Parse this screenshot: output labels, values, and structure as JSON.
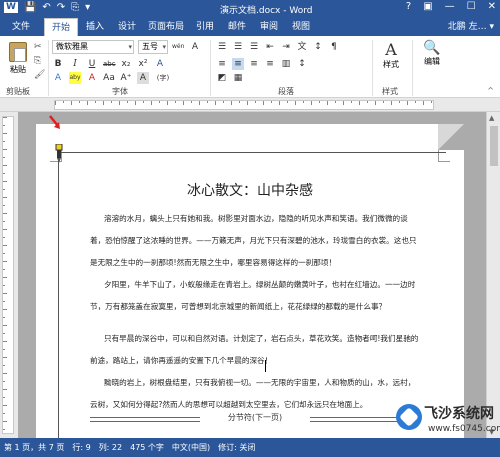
{
  "titlebar": {
    "quick_access": [
      "W",
      "💾",
      "↶",
      "↷",
      "⎘",
      "▾"
    ],
    "title": "演示文档.docx - Word",
    "window_buttons": [
      "?",
      "▣",
      "—",
      "☐",
      "✕"
    ]
  },
  "tabs": {
    "file": "文件",
    "items": [
      "开始",
      "插入",
      "设计",
      "页面布局",
      "引用",
      "邮件",
      "审阅",
      "视图"
    ],
    "active": "开始",
    "user": "北鹏 左… ▾"
  },
  "ribbon": {
    "paste_label": "粘贴",
    "clipboard_label": "剪贴板",
    "font_name": "微软雅黑",
    "font_size": "五号",
    "font_group_label": "字体",
    "paragraph_group_label": "段落",
    "styles_label": "样式",
    "editing_label": "编辑",
    "styles_big": "A",
    "editing_icon": "🔍",
    "format_row1": [
      "wén",
      "A",
      "A⁺",
      "A⁻",
      "Aa",
      "Ā"
    ],
    "format_row2": [
      "B",
      "I",
      "U",
      "abc",
      "x₂",
      "x²",
      "A"
    ],
    "format_row3": [
      "A",
      "aby",
      "A",
      "Aa",
      "A⁺",
      "A",
      "(字)"
    ],
    "para_row1": [
      "☰",
      "☰",
      "☰",
      "☰",
      "⇤",
      "⇥",
      "文",
      "↕",
      "¶"
    ],
    "para_row2": [
      "≡",
      "≡",
      "≡",
      "≡",
      "▥",
      "↕",
      "◩",
      "▦"
    ]
  },
  "document": {
    "title": "冰心散文：山中杂感",
    "paragraphs": [
      "溶溶的水月，螭头上只有她和我。树影里对面水边，隐隐的听见水声和笑语。我们微微的谈着，恐怕惊醒了这浓睡的世界。——万籁无声，月光下只有深碧的池水，玲珑雪白的衣裳。这也只是无限之生中的一刹那顷!然而无限之生中，哪里容易得这样的一刹那顷！",
      "夕阳里，牛羊下山了，小蚁般缘走在青岩上。绿树丛颠的嫩黄叶子，也衬在红墙边。一一边时节，万有都笼盖在寂寞里，可曾想到北京城里的新闻纸上，花花绿绿的都载的是什么事？",
      "只有早晨的深谷中，可以和自然对语。计划定了，岩石点头，草花欢笑。造物者呵!我们星驰的前途，路站上，请你再遥遥的安置下几个早晨的深谷！",
      "黝晓的岩上，树根盘结里，只有我俯视一切。——无限的宇宙里，人和物质的山，水，远村，云树，又如何分得起?然而人的思想可以超越到太空里去，它们却永远只在地面上。"
    ],
    "section_break": "分节符(下一页)"
  },
  "statusbar": {
    "items": [
      "第 1 页，共 7 页",
      "行: 9",
      "列: 22",
      "475 个字",
      "中文(中国)",
      "修订: 关闭"
    ]
  },
  "watermark": {
    "text": "飞沙系统网",
    "url": "www.fs0745.com"
  },
  "colors": {
    "word_blue": "#2b579a",
    "page_bg": "#ffffff",
    "canvas_bg": "#ababab",
    "tab_bg": "#ffffff"
  }
}
